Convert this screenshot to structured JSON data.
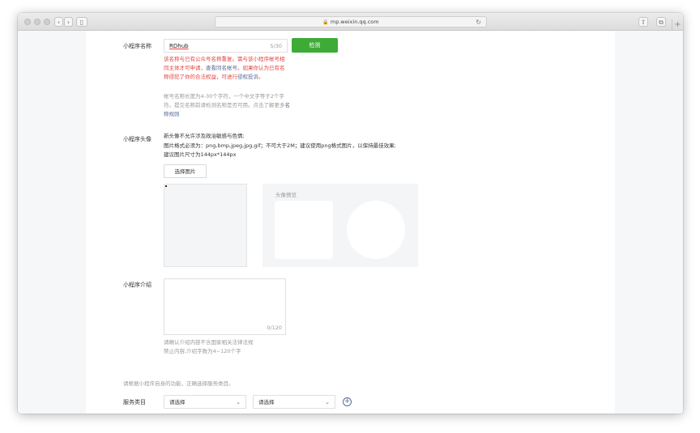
{
  "browser": {
    "url": "mp.weixin.qq.com",
    "icons": {
      "back": "chevron-left-icon",
      "forward": "chevron-right-icon",
      "sidebar": "sidebar-icon",
      "lock": "lock-icon",
      "reload": "reload-icon",
      "share": "share-icon",
      "tabs": "tabs-icon",
      "new_tab": "plus-icon"
    }
  },
  "name_section": {
    "label": "小程序名称",
    "value": "RDhub",
    "count": "5/30",
    "check_button": "检测",
    "warning_part1": "该名称与已有公众号名称重复。需与该小程序帐号相同主体才可申请，",
    "warning_link1": "查看同名帐号",
    "warning_part2": "。如果你认为已有名称侵犯了你的合法权益，可进行",
    "warning_link2": "侵权投诉",
    "warning_part3": "。",
    "hint_text": "帐号名称长度为4-30个字符，一个中文字等于2个字符。提交名称前请检测名称是否可用。点击了解更多",
    "hint_link": "名称规则"
  },
  "avatar_section": {
    "label": "小程序头像",
    "desc_line1": "新头像不允许涉及政治敏感与色情;",
    "desc_line2": "图片格式必须为：png,bmp,jpeg,jpg,gif；不可大于2M；建议使用png格式图片，以保持最佳效果;",
    "desc_line3": "建议图片尺寸为144px*144px",
    "select_button": "选择图片",
    "preview_title": "头像预览"
  },
  "intro_section": {
    "label": "小程序介绍",
    "count": "0/120",
    "hint_line1": "请确认介绍内容不含国家相关法律法规",
    "hint_line2": "禁止内容,介绍字数为4~120个字"
  },
  "category_section": {
    "hint": "请根据小程序自身的功能，正确选择服务类目。",
    "label": "服务类目",
    "select1": "请选择",
    "select2": "请选择"
  }
}
